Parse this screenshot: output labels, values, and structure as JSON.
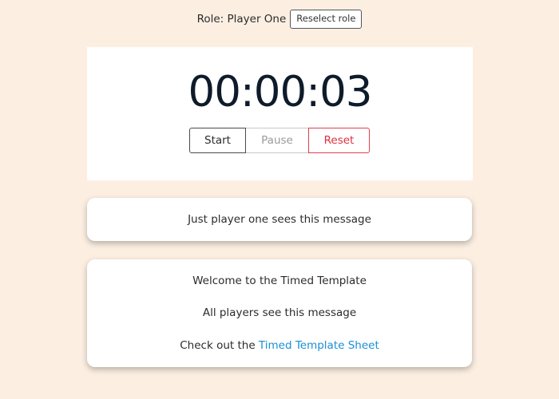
{
  "role_bar": {
    "role_label": "Role: Player One",
    "reselect_label": "Reselect role"
  },
  "timer": {
    "display": "00:00:03",
    "start_label": "Start",
    "pause_label": "Pause",
    "reset_label": "Reset"
  },
  "player_card": {
    "message": "Just player one sees this message"
  },
  "all_card": {
    "welcome": "Welcome to the Timed Template",
    "all_players": "All players see this message",
    "check_prefix": "Check out the ",
    "link_text": "Timed Template Sheet"
  },
  "colors": {
    "background": "#fcefe2",
    "link": "#1a8fd6",
    "reset": "#e03040",
    "timer_text": "#0e1b2b"
  }
}
